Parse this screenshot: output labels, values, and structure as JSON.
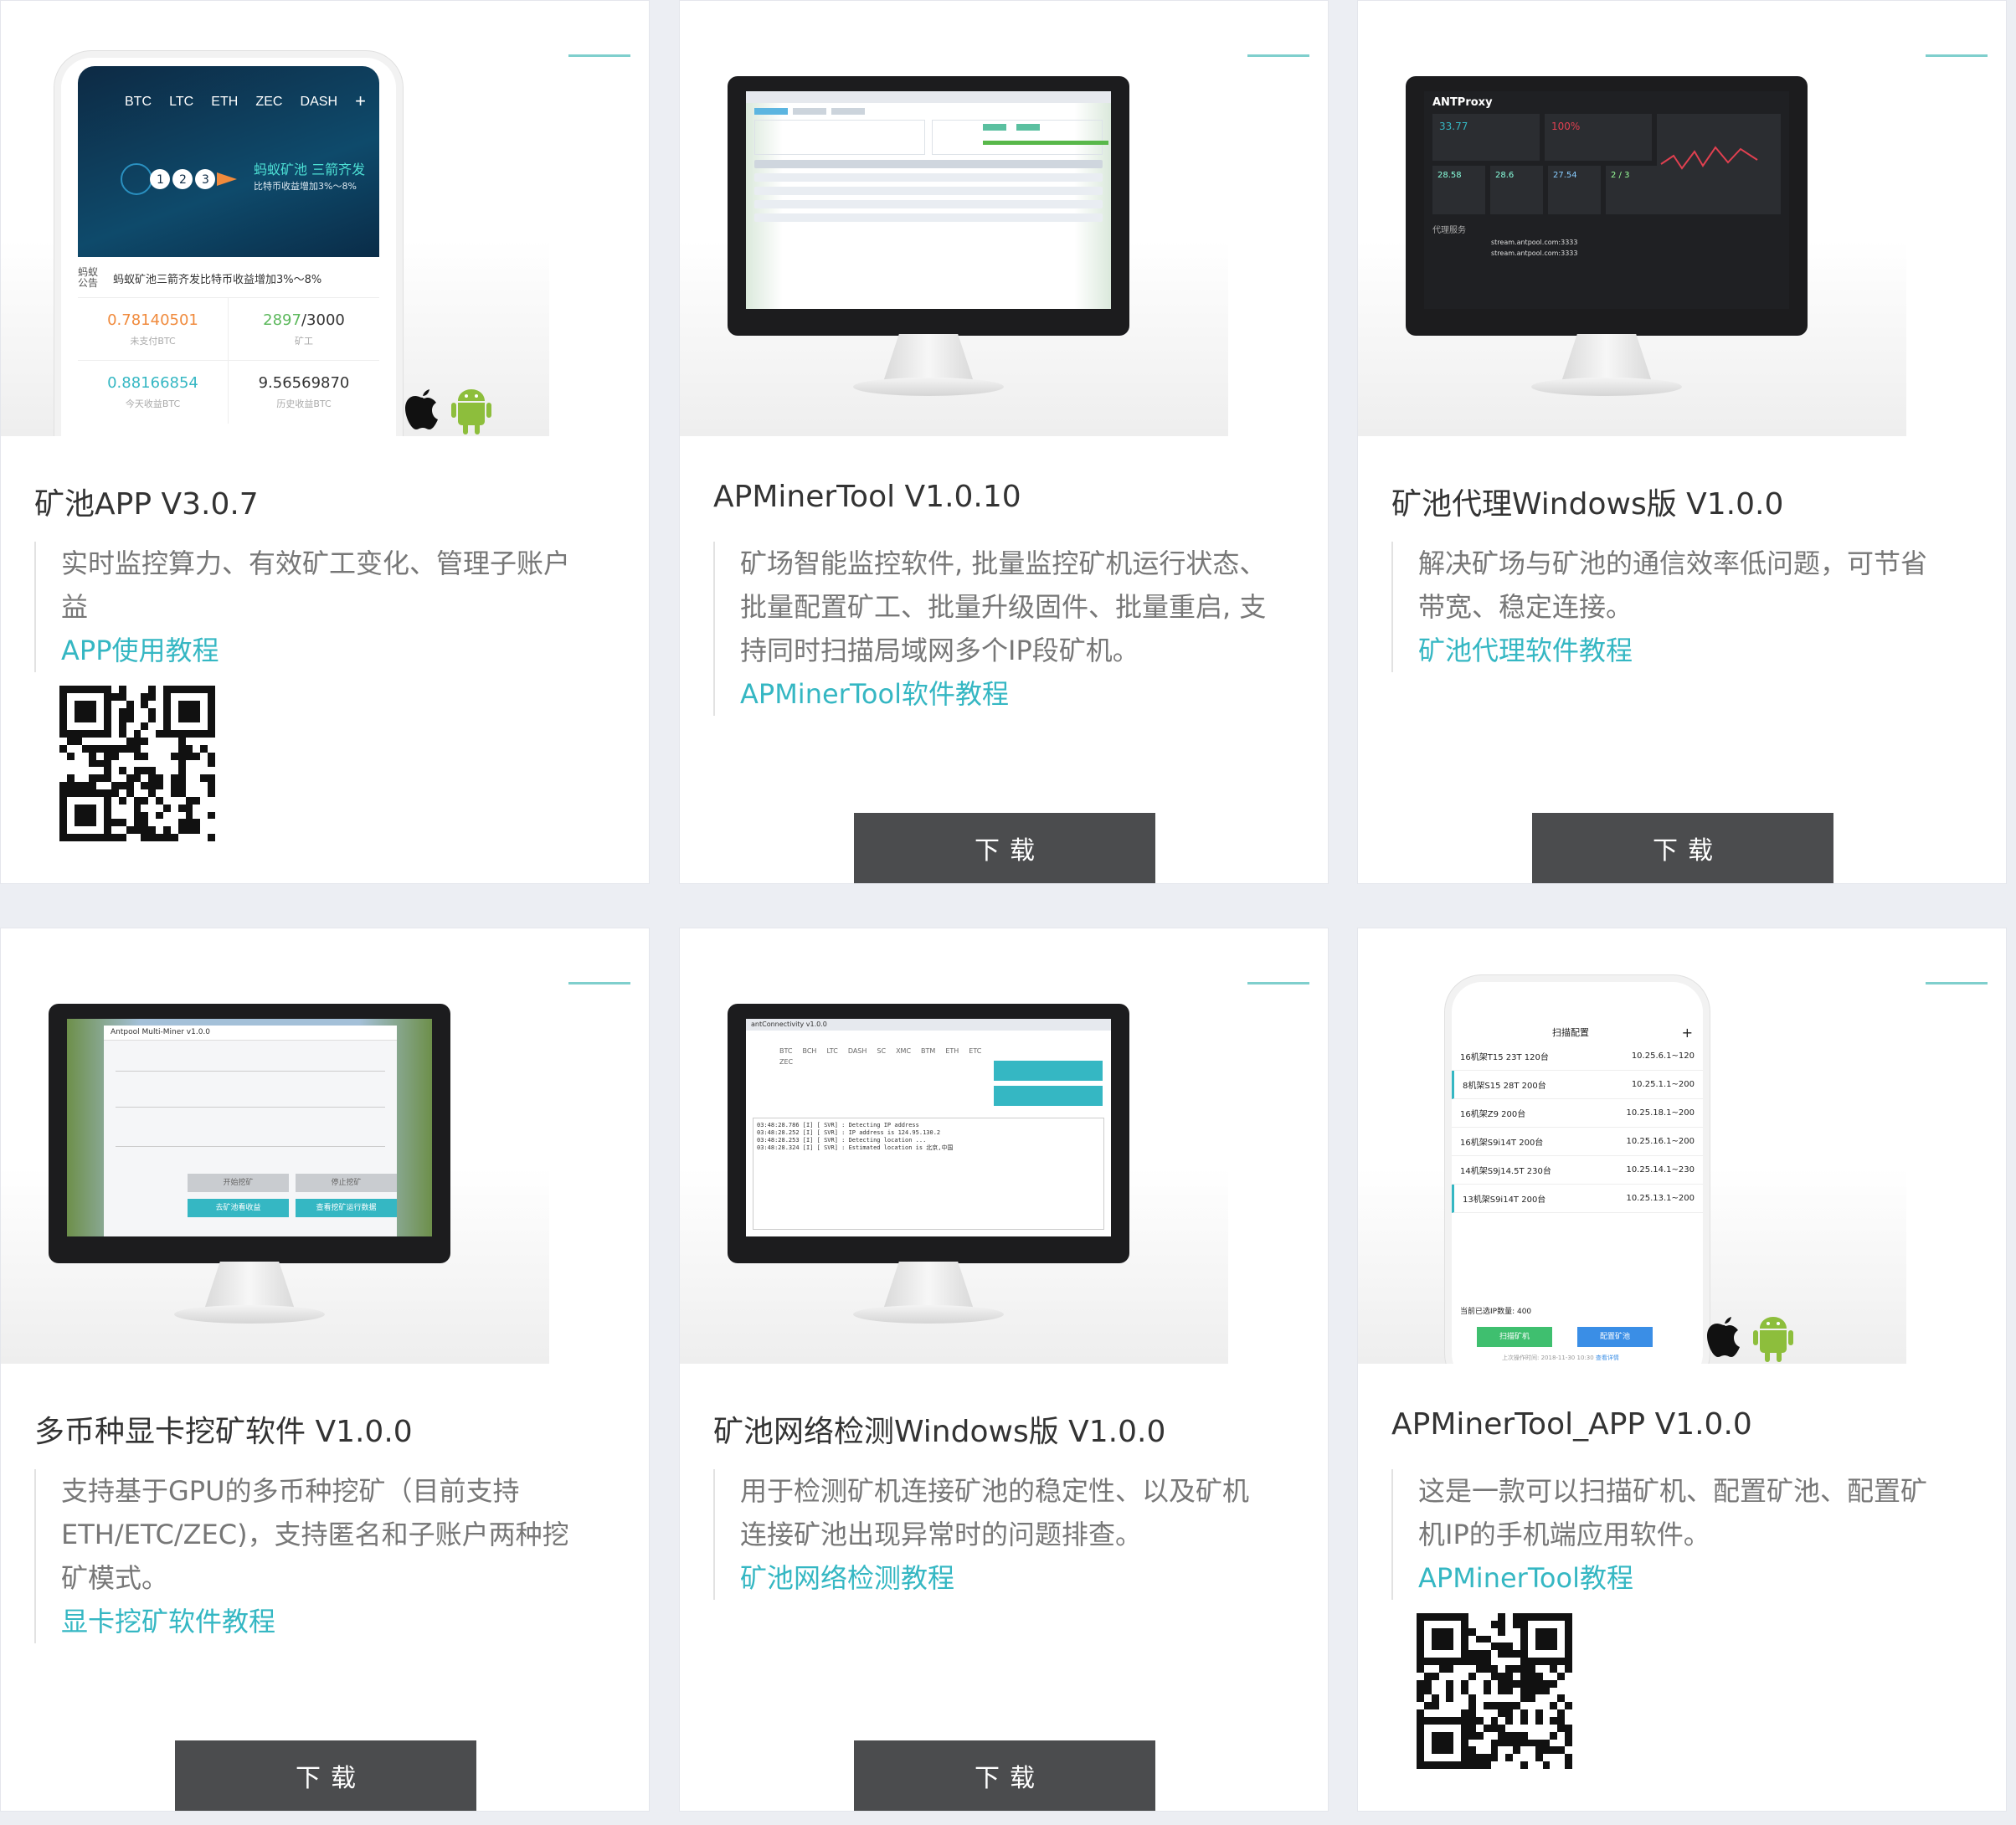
{
  "cards": [
    {
      "title": "矿池APP V3.0.7",
      "description": "实时监控算力、有效矿工变化、管理子账户益",
      "link": "APP使用教程",
      "has_qr": true,
      "phone": {
        "tabs": [
          "BTC",
          "LTC",
          "ETH",
          "ZEC",
          "DASH",
          "+"
        ],
        "banner_title": "蚂蚁矿池 三箭齐发",
        "banner_subtitle": "比特币收益增加3%～8%",
        "notice_label": "蚂蚁公告",
        "notice_text": "蚂蚁矿池三箭齐发比特币收益增加3%～8%",
        "stats": [
          {
            "value": "0.78140501",
            "label": "未支付BTC",
            "color": "#f08a3c"
          },
          {
            "value_active": "2897",
            "value_total": "/3000",
            "label": "矿工",
            "color": "#5cb85c"
          },
          {
            "value": "0.88166854",
            "label": "今天收益BTC",
            "color": "#35b7c3"
          },
          {
            "value": "9.56569870",
            "label": "历史收益BTC",
            "color": "#333333"
          }
        ]
      }
    },
    {
      "title": "APMinerTool V1.0.10",
      "description": "矿场智能监控软件, 批量监控矿机运行状态、批量配置矿工、批量升级固件、批量重启, 支持同时扫描局域网多个IP段矿机。",
      "link": "APMinerTool软件教程",
      "button": "下载"
    },
    {
      "title": "矿池代理Windows版 V1.0.0",
      "description": "解决矿场与矿池的通信效率低问题，可节省带宽、稳定连接。",
      "link": "矿池代理软件教程",
      "button": "下载",
      "screen": {
        "brand": "ANTProxy",
        "stat1": "33.77",
        "stat2": "100%",
        "small_stats": [
          "28.58",
          "28.6",
          "27.54",
          "2 / 3"
        ],
        "table_title": "代理服务",
        "table_rows": [
          "stream.antpool.com:3333",
          "stream.antpool.com:3333"
        ]
      }
    },
    {
      "title": "多币种显卡挖矿软件 V1.0.0",
      "description": "支持基于GPU的多币种挖矿（目前支持ETH/ETC/ZEC)，支持匿名和子账户两种挖矿模式。",
      "link": "显卡挖矿软件教程",
      "button": "下载",
      "screen": {
        "window_title": "Antpool Multi-Miner v1.0.0",
        "btn_start": "开始挖矿",
        "btn_stop": "停止挖矿",
        "btn_view": "去矿池看收益",
        "btn_status": "查看挖矿运行数据"
      }
    },
    {
      "title": "矿池网络检测Windows版 V1.0.0",
      "description": "用于检测矿机连接矿池的稳定性、以及矿机连接矿池出现异常时的问题排查。",
      "link": "矿池网络检测教程",
      "button": "下载",
      "screen": {
        "window_title": "antConnectivity v1.0.0",
        "coins": [
          "BTC",
          "BCH",
          "LTC",
          "DASH",
          "SC",
          "XMC",
          "BTM",
          "ETH",
          "ETC",
          "ZEC"
        ],
        "log_lines": [
          "03:48:28.786 [I] [ SVR] : Detecting IP address",
          "03:48:28.252 [I] [ SVR] : IP address is 124.95.130.2",
          "03:48:28.253 [I] [ SVR] : Detecting location ...",
          "03:48:28.324 [I] [ SVR] : Estimated location is 北京,中国"
        ]
      }
    },
    {
      "title": "APMinerTool_APP V1.0.0",
      "description": "这是一款可以扫描矿机、配置矿池、配置矿机IP的手机端应用软件。",
      "link": "APMinerTool教程",
      "has_qr": true,
      "phone": {
        "header": "扫描配置",
        "rows": [
          {
            "name": "16机架T15 23T 120台",
            "ip": "10.25.6.1~120"
          },
          {
            "name": "8机架S15 28T 200台",
            "ip": "10.25.1.1~200"
          },
          {
            "name": "16机架Z9 200台",
            "ip": "10.25.18.1~200"
          },
          {
            "name": "16机架S9i14T 200台",
            "ip": "10.25.16.1~200"
          },
          {
            "name": "14机架S9j14.5T 230台",
            "ip": "10.25.14.1~230"
          },
          {
            "name": "13机架S9i14T 200台",
            "ip": "10.25.13.1~200"
          }
        ],
        "count_text": "当前已选IP数量: 400",
        "btn_scan": "扫描矿机",
        "btn_config": "配置矿池",
        "footer_text": "上次操作时间: 2018-11-30 10:30",
        "footer_link": "查看详情"
      }
    }
  ],
  "colors": {
    "accent": "#7fcfcd",
    "link": "#35b7c3",
    "button": "#4b4c4e",
    "apple": "#111111",
    "android": "#8dbe3c"
  },
  "icons": [
    "apple-icon",
    "android-icon",
    "qr-code"
  ]
}
